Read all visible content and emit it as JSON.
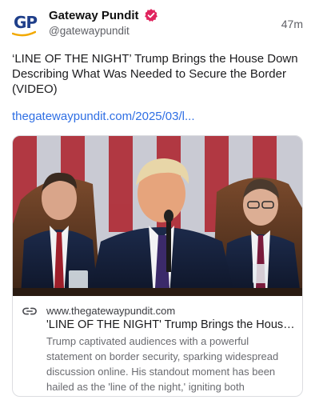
{
  "author": {
    "name": "Gateway Pundit",
    "handle": "@gatewaypundit",
    "avatar_text": "GP",
    "time": "47m",
    "verified": true
  },
  "post": {
    "text": "‘LINE OF THE NIGHT’ Trump Brings the House Down Describing What Was Needed to Secure the Border (VIDEO)",
    "link_text": "thegatewaypundit.com/2025/03/l..."
  },
  "card": {
    "domain": "www.thegatewaypundit.com",
    "title": "'LINE OF THE NIGHT' Trump Brings the House ...",
    "description": "Trump captivated audiences with a powerful statement on border security, sparking widespread discussion online. His standout moment has been hailed as the 'line of the night,' igniting both enthusiasm and debate."
  },
  "colors": {
    "link": "#2f6fe4",
    "verified_badge": "#e0245e",
    "avatar_blue": "#1f3f8a",
    "avatar_gold": "#f2a900"
  },
  "icons": [
    "verified-badge-icon",
    "link-icon"
  ]
}
